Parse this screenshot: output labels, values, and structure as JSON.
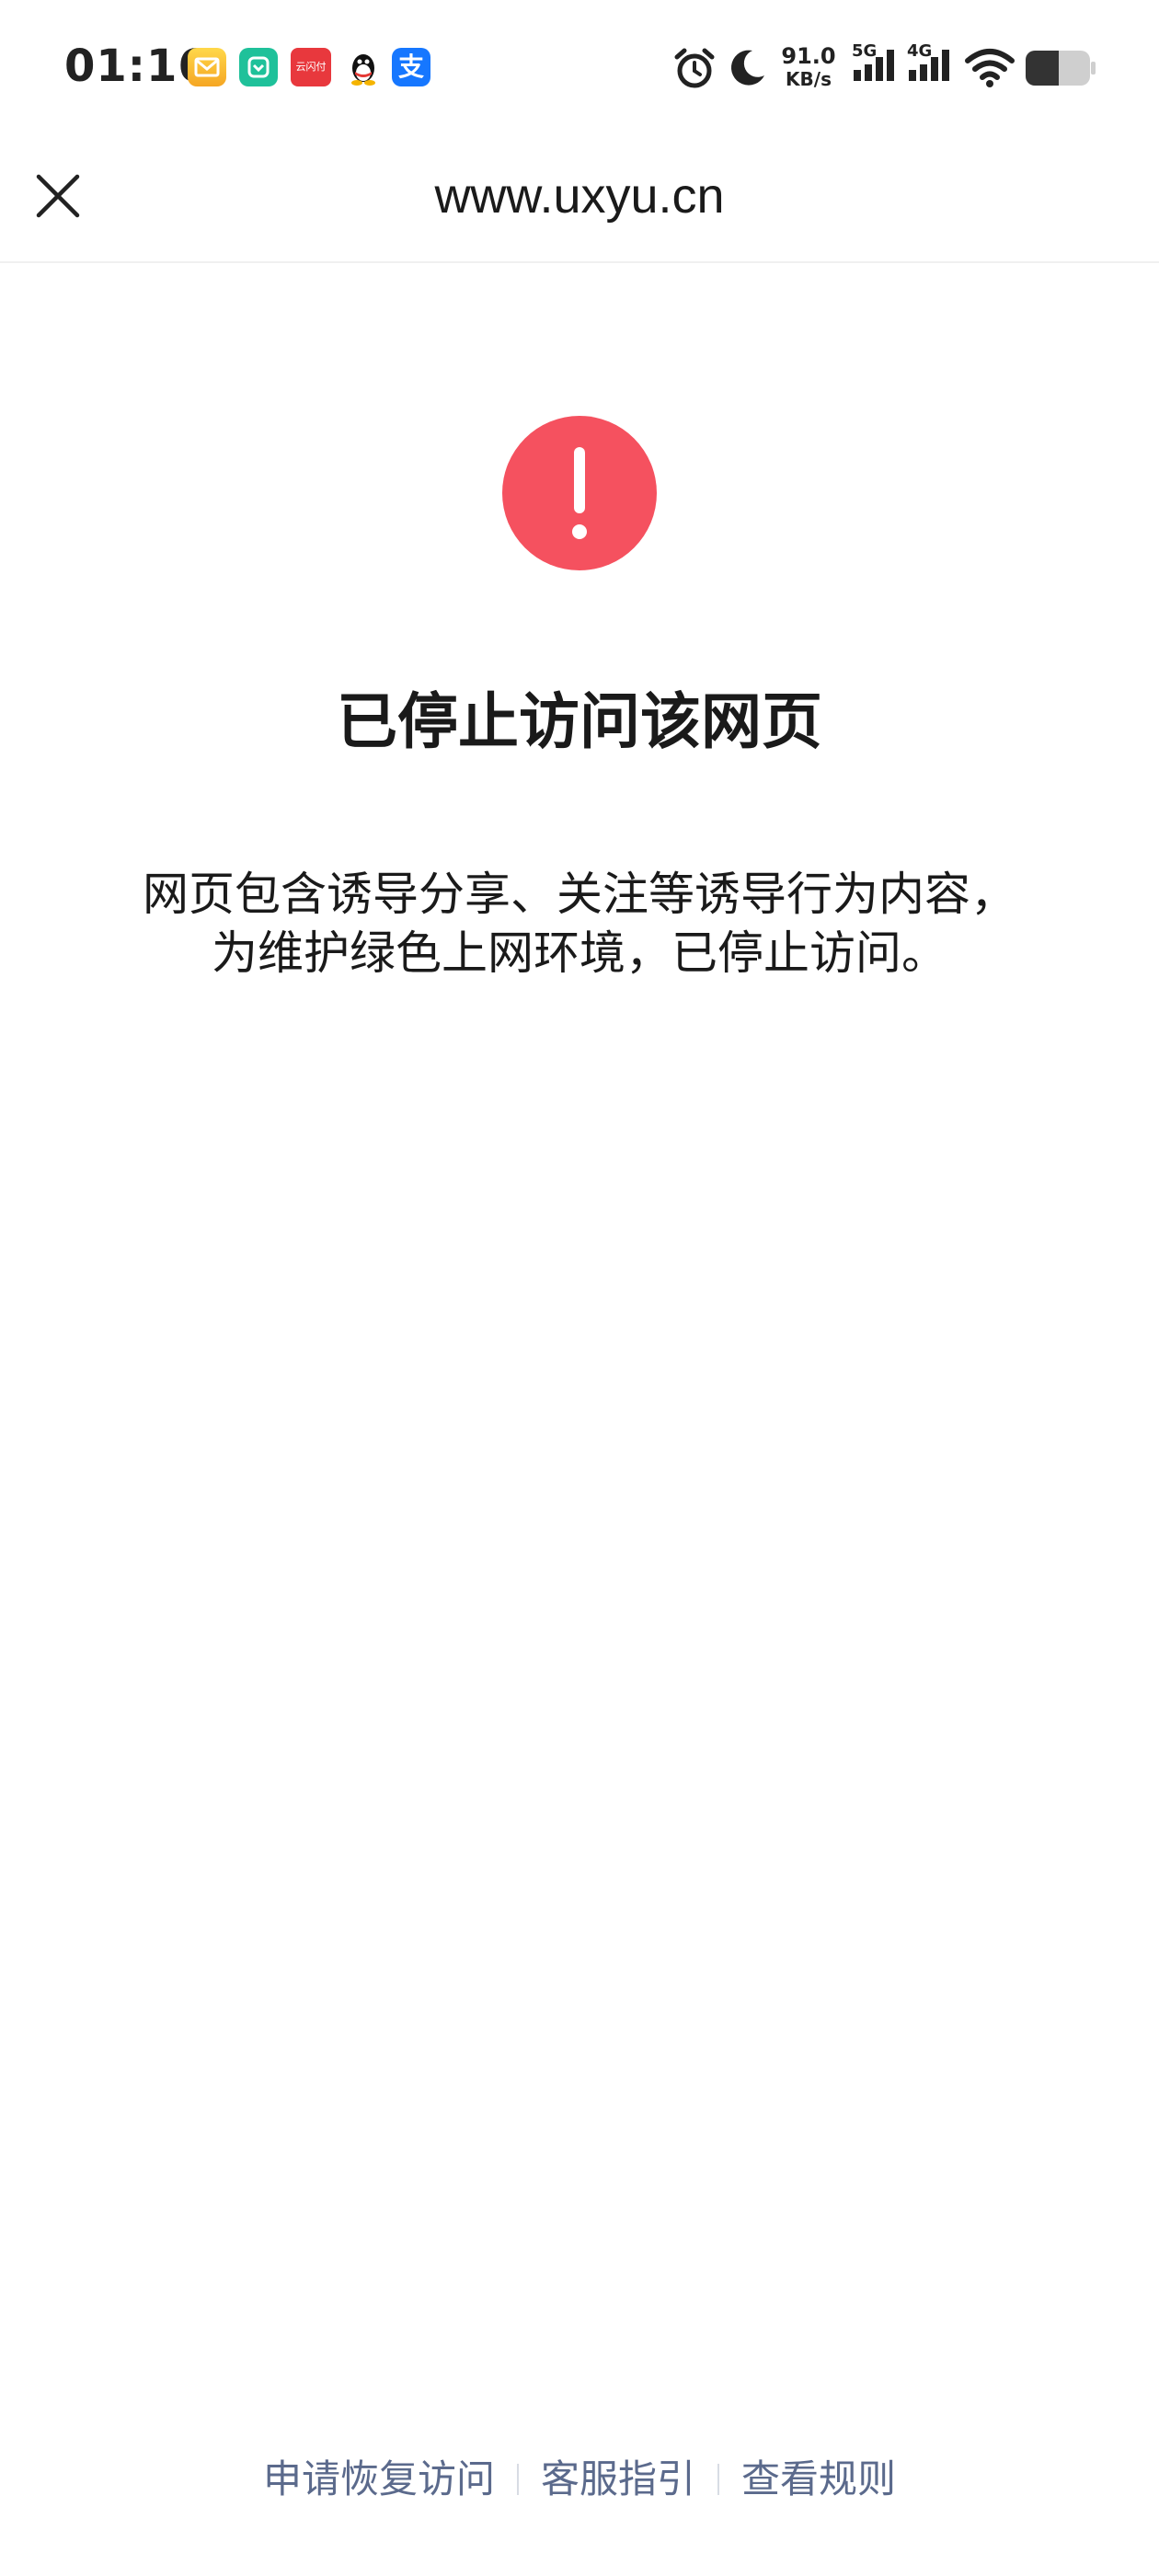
{
  "status_bar": {
    "time": "01:16",
    "network_speed_value": "91.0",
    "network_speed_unit": "KB/s",
    "signal_1_label": "5G",
    "signal_2_label": "4G",
    "notification_icons": [
      "mail-app-icon",
      "mijia-app-icon",
      "ticket-app-icon",
      "qq-icon",
      "alipay-icon"
    ],
    "alipay_glyph": "支",
    "ticket_glyph": "云闪付"
  },
  "nav": {
    "title": "www.uxyu.cn"
  },
  "main": {
    "heading": "已停止访问该网页",
    "description_line_1": "网页包含诱导分享、关注等诱导行为内容，",
    "description_line_2": "为维护绿色上网环境，已停止访问。",
    "warning_color": "#f5515f"
  },
  "footer": {
    "link_1": "申请恢复访问",
    "link_2": "客服指引",
    "link_3": "查看规则",
    "link_color": "#5b6a8c"
  }
}
